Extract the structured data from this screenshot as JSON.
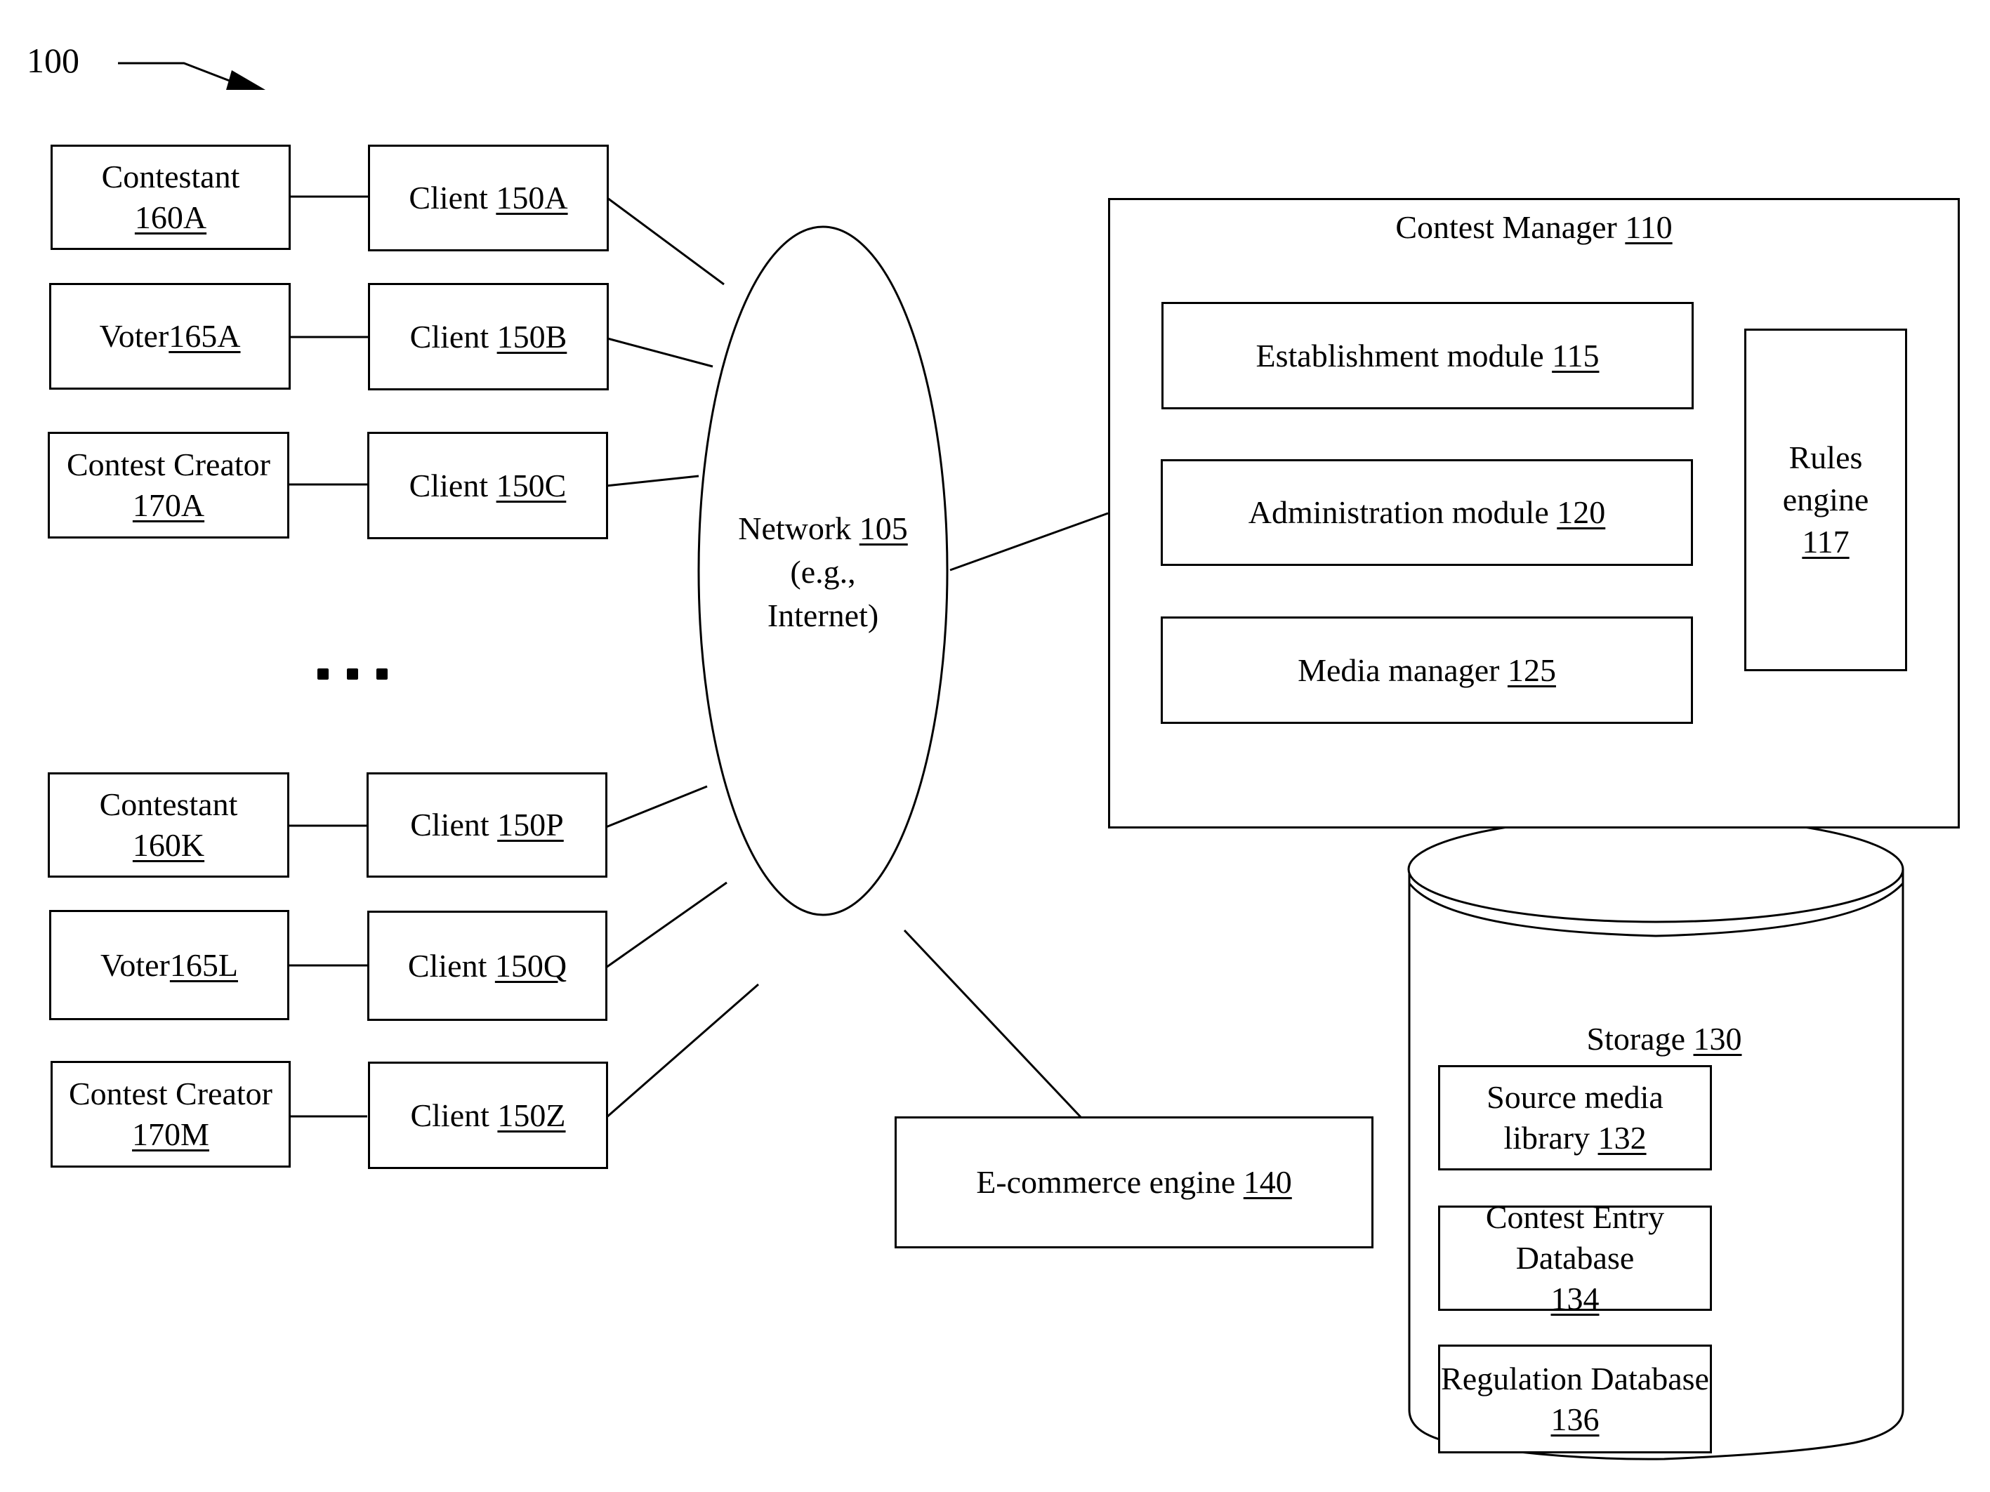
{
  "figure": {
    "number": "100",
    "colors": {
      "line": "#000000",
      "background": "#ffffff"
    }
  },
  "users": [
    {
      "role": "Contestant",
      "ref": "160A"
    },
    {
      "role": "Voter",
      "ref": "165A"
    },
    {
      "role": "Contest Creator",
      "ref": "170A"
    },
    {
      "role": "Contestant",
      "ref": "160K"
    },
    {
      "role": "Voter",
      "ref": "165L"
    },
    {
      "role": "Contest Creator",
      "ref": "170M"
    }
  ],
  "clients": [
    {
      "label": "Client",
      "ref": "150A"
    },
    {
      "label": "Client",
      "ref": "150B"
    },
    {
      "label": "Client",
      "ref": "150C"
    },
    {
      "label": "Client",
      "ref": "150P"
    },
    {
      "label": "Client",
      "ref": "150Q"
    },
    {
      "label": "Client",
      "ref": "150Z"
    }
  ],
  "ellipsis": "...",
  "network": {
    "label": "Network",
    "ref": "105",
    "note_line1": "(e.g.,",
    "note_line2": "Internet)"
  },
  "contest_manager": {
    "label": "Contest Manager",
    "ref": "110",
    "modules": [
      {
        "label": "Establishment module",
        "ref": "115"
      },
      {
        "label": "Administration module",
        "ref": "120"
      },
      {
        "label": "Media manager",
        "ref": "125"
      }
    ],
    "rules_engine": {
      "line1": "Rules",
      "line2": "engine",
      "ref": "117"
    }
  },
  "storage": {
    "label": "Storage",
    "ref": "130",
    "items": [
      {
        "label": "Source media library",
        "ref": "132"
      },
      {
        "label": "Contest Entry Database",
        "ref": "134"
      },
      {
        "label": "Regulation Database",
        "ref": "136"
      }
    ]
  },
  "ecommerce": {
    "label": "E-commerce engine",
    "ref": "140"
  }
}
